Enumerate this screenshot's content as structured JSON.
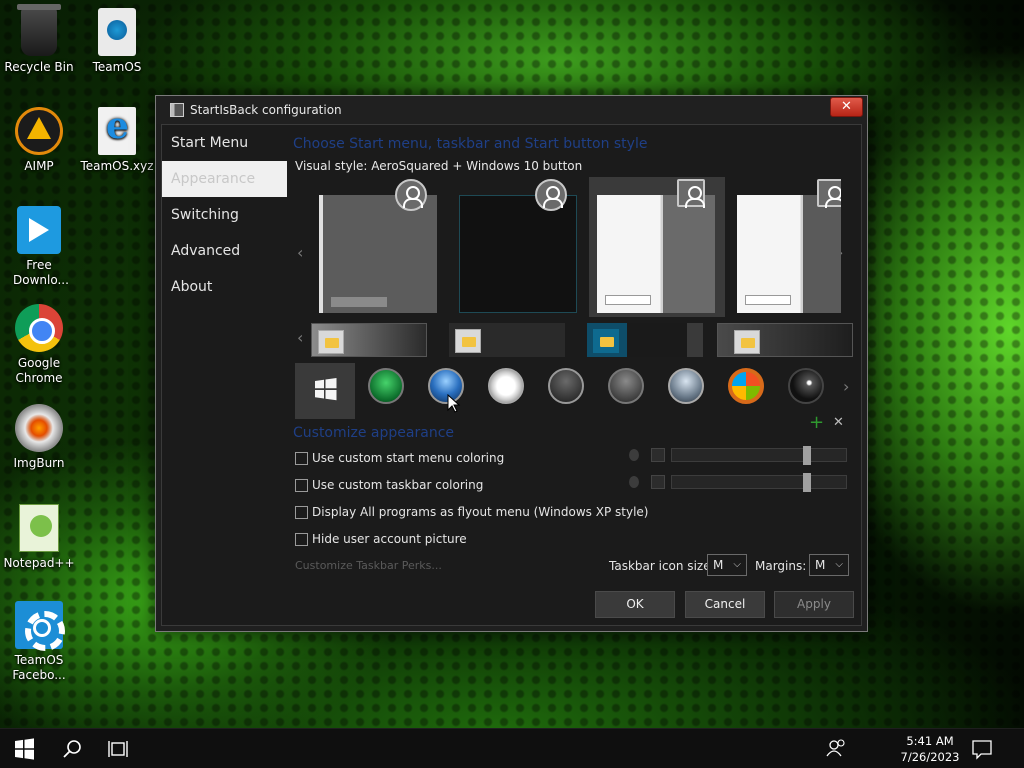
{
  "desktop": {
    "icons": [
      {
        "label": "Recycle Bin",
        "icon": "recycle-bin-icon"
      },
      {
        "label": "TeamOS",
        "icon": "teamos-file-icon"
      },
      {
        "label": "AIMP",
        "icon": "aimp-icon"
      },
      {
        "label": "TeamOS.xyz",
        "icon": "internet-explorer-icon"
      },
      {
        "label": "Free Downlo...",
        "icon": "free-download-manager-icon"
      },
      {
        "label": "Google Chrome",
        "icon": "chrome-icon"
      },
      {
        "label": "ImgBurn",
        "icon": "imgburn-icon"
      },
      {
        "label": "Notepad++",
        "icon": "notepadpp-icon"
      },
      {
        "label": "TeamOS Facebo...",
        "icon": "gear-icon"
      }
    ]
  },
  "window": {
    "title": "StartIsBack configuration",
    "close_label": "✕",
    "nav": [
      {
        "label": "Start Menu"
      },
      {
        "label": "Appearance"
      },
      {
        "label": "Switching"
      },
      {
        "label": "Advanced"
      },
      {
        "label": "About"
      }
    ],
    "selected_nav": "Appearance",
    "style_section_title": "Choose Start menu, taskbar and Start button style",
    "visual_style_text": "Visual style:  AeroSquared + Windows 10 button",
    "customize_title": "Customize appearance",
    "checkboxes": [
      {
        "label": "Use custom start menu coloring",
        "checked": false
      },
      {
        "label": "Use custom taskbar coloring",
        "checked": false
      },
      {
        "label": "Display All programs as flyout menu (Windows XP style)",
        "checked": false
      },
      {
        "label": "Hide user account picture",
        "checked": false
      }
    ],
    "slider_levels": [
      0.75,
      0.75
    ],
    "perks_label": "Customize Taskbar Perks...",
    "icon_size_label": "Taskbar icon size:",
    "icon_size_value": "M",
    "margins_label": "Margins:",
    "margins_value": "M",
    "ok_label": "OK",
    "cancel_label": "Cancel",
    "apply_label": "Apply",
    "add_label": "+",
    "remove_label": "✕"
  },
  "taskbar": {
    "time": "5:41 AM",
    "date": "7/26/2023"
  },
  "colors": {
    "section_title": "#1f3f86",
    "close_button": "#c8321f",
    "add_green": "#2f9a2f"
  }
}
